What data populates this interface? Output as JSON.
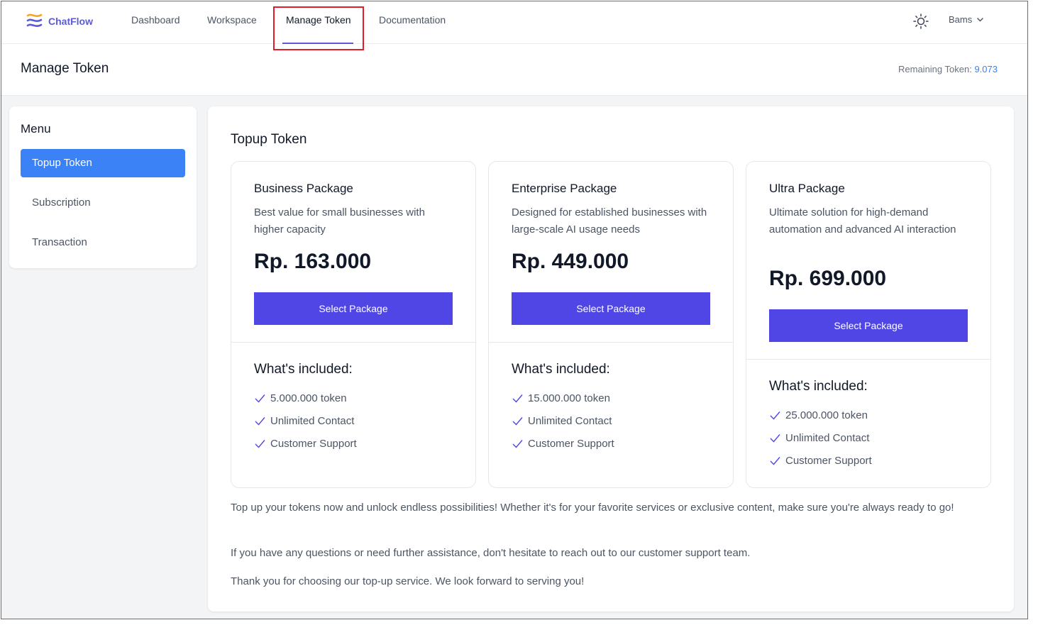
{
  "brand": {
    "name": "ChatFlow",
    "accent": "#5b5bd6"
  },
  "nav": {
    "links": [
      {
        "label": "Dashboard"
      },
      {
        "label": "Workspace"
      },
      {
        "label": "Manage Token"
      },
      {
        "label": "Documentation"
      }
    ],
    "active": "Manage Token",
    "theme_icon": "sun-icon",
    "user": "Bams"
  },
  "header": {
    "title": "Manage Token",
    "remaining_label": "Remaining Token:",
    "remaining_value": "9.073"
  },
  "sidebar": {
    "title": "Menu",
    "items": [
      {
        "label": "Topup Token",
        "active": true
      },
      {
        "label": "Subscription",
        "active": false
      },
      {
        "label": "Transaction",
        "active": false
      }
    ]
  },
  "main": {
    "title": "Topup Token",
    "cards": [
      {
        "name": "Business Package",
        "description": "Best value for small businesses with higher capacity",
        "price": "Rp. 163.000",
        "button": "Select Package",
        "included_title": "What's included:",
        "features": [
          "5.000.000 token",
          "Unlimited Contact",
          "Customer Support"
        ]
      },
      {
        "name": "Enterprise Package",
        "description": "Designed for established businesses with large-scale AI usage needs",
        "price": "Rp. 449.000",
        "button": "Select Package",
        "included_title": "What's included:",
        "features": [
          "15.000.000 token",
          "Unlimited Contact",
          "Customer Support"
        ]
      },
      {
        "name": "Ultra Package",
        "description": "Ultimate solution for high-demand automation and advanced AI interaction",
        "price": "Rp. 699.000",
        "button": "Select Package",
        "included_title": "What's included:",
        "features": [
          "25.000.000 token",
          "Unlimited Contact",
          "Customer Support"
        ]
      }
    ],
    "paragraphs": [
      "Top up your tokens now and unlock endless possibilities! Whether it's for your favorite services or exclusive content, make sure you're always ready to go!",
      "If you have any questions or need further assistance, don't hesitate to reach out to our customer support team.",
      "Thank you for choosing our top-up service. We look forward to serving you!"
    ]
  },
  "colors": {
    "primary_button": "#4f46e5",
    "sidebar_active": "#3b82f6",
    "highlight": "#e11d2a"
  }
}
